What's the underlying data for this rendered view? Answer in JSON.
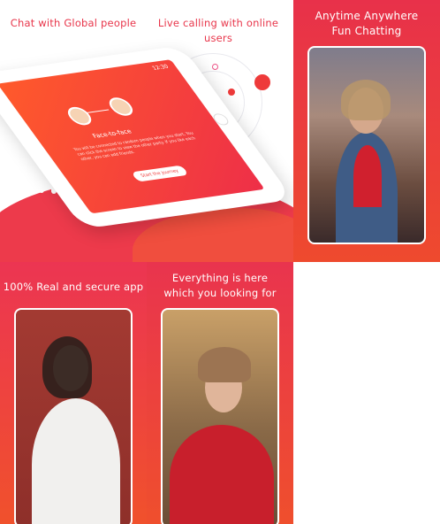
{
  "panels": {
    "chat": {
      "caption": "Chat with Global people"
    },
    "calling": {
      "caption": "Live calling with online users"
    },
    "anytime": {
      "caption_line1": "Anytime Anywhere",
      "caption_line2": "Fun Chatting"
    },
    "secure": {
      "caption": "100% Real and secure app"
    },
    "everything": {
      "caption_line1": "Everything is here",
      "caption_line2": "which you looking for"
    }
  },
  "phone_screen": {
    "title": "Face-to-face",
    "description": "You will be connected to random people when you start, You can click the screen to view the other party. If you like each other, you can add friends.",
    "start_button": "Start the journey",
    "status": "12:30"
  },
  "colors": {
    "accent": "#ed3a4b",
    "accent_orange": "#f0512c",
    "white": "#ffffff"
  },
  "icons": [
    "heartbeat-icon",
    "home-button-icon",
    "radar-rings"
  ]
}
